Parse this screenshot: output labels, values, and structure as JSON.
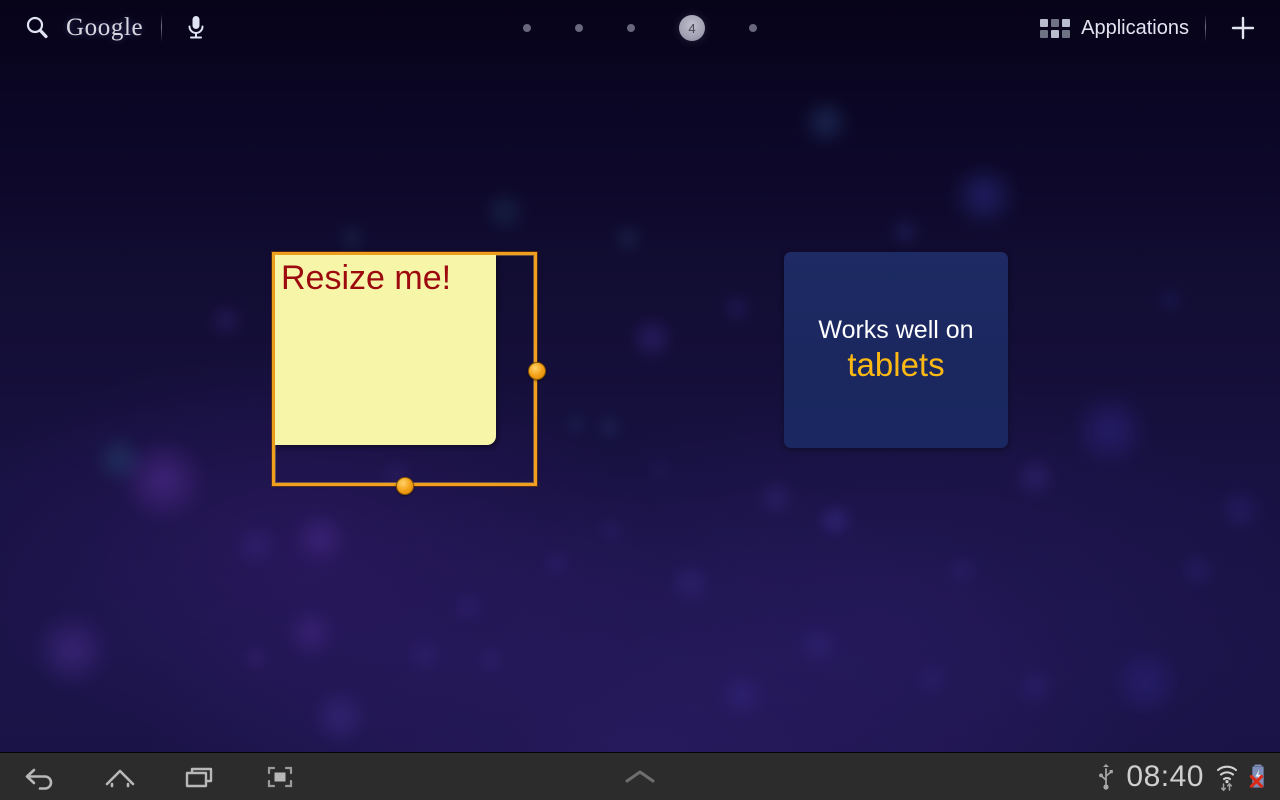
{
  "statusbar": {
    "search_label": "Google",
    "search_icon": "magnifier-icon",
    "mic_icon": "microphone-icon",
    "apps_label": "Applications",
    "apps_icon": "apps-grid-icon",
    "add_icon": "plus-icon"
  },
  "pages": {
    "count": 5,
    "current_index": 4,
    "current_label": "4",
    "dots": [
      "",
      "",
      "",
      "4",
      ""
    ]
  },
  "widgets": {
    "note": {
      "text": "Resize me!",
      "selected": true,
      "text_color": "#9c0a0f",
      "paper_color": "#f7f6a8",
      "selection_color": "#f0a01e",
      "handles": [
        "resize-handle-right",
        "resize-handle-bottom"
      ]
    },
    "tablets": {
      "line1": "Works well on",
      "line2": "tablets",
      "line1_color": "#ffffff",
      "line2_color": "#fcb813",
      "background_color": "#1d2a63"
    }
  },
  "navbar": {
    "back_icon": "back-arrow-icon",
    "home_icon": "home-icon",
    "recents_icon": "recent-apps-icon",
    "screenshot_icon": "screenshot-icon",
    "shade_icon": "chevron-up-icon"
  },
  "systray": {
    "usb_icon": "usb-icon",
    "time": "08:40",
    "wifi_icon": "wifi-signal-icon",
    "data_icon": "data-transfer-icon",
    "battery_icon": "battery-error-icon"
  },
  "theme": {
    "wallpaper_base": "#181243",
    "navbar_color": "#2c2c2c",
    "accent_orange": "#f0a01e"
  }
}
